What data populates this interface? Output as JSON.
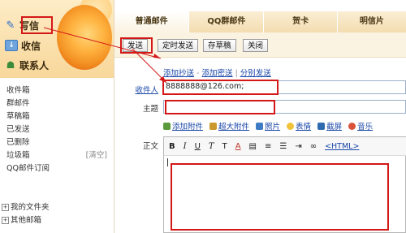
{
  "sidebar": {
    "write_label": "写信",
    "inbox_label": "收信",
    "contacts_label": "联系人",
    "folders": [
      {
        "label": "收件箱",
        "extra": ""
      },
      {
        "label": "群邮件",
        "extra": ""
      },
      {
        "label": "草稿箱",
        "extra": ""
      },
      {
        "label": "已发送",
        "extra": ""
      },
      {
        "label": "已删除",
        "extra": ""
      },
      {
        "label": "垃圾箱",
        "extra": "[清空]"
      },
      {
        "label": "QQ邮件订阅",
        "extra": ""
      }
    ],
    "tree": [
      {
        "label": "我的文件夹"
      },
      {
        "label": "其他邮箱"
      }
    ]
  },
  "tabs": [
    "普通邮件",
    "QQ群邮件",
    "贺卡",
    "明信片"
  ],
  "toolbar": {
    "send": "发送",
    "scheduled": "定时发送",
    "draft": "存草稿",
    "close": "关闭"
  },
  "compose": {
    "add_cc": "添加抄送",
    "add_bcc": "添加密送",
    "separate_send": "分别发送",
    "separator": "-",
    "separator2": "|",
    "recipient_label": "收件人",
    "recipient_value": "8888888@126.com;",
    "subject_label": "主题",
    "subject_value": "",
    "body_label": "正文"
  },
  "attach_bar": {
    "add_attachment": "添加附件",
    "big_attachment": "超大附件",
    "photo": "照片",
    "emoji": "表情",
    "screenshot": "截屏",
    "music": "音乐"
  },
  "editor_toolbar": {
    "bold": "B",
    "italic": "I",
    "underline": "U",
    "font": "T",
    "size": "T",
    "color": "A",
    "html_mode": "<HTML>"
  },
  "colors": {
    "accent_red": "#d41818",
    "link_blue": "#1a47a8",
    "tab_bg": "#f3dcb0"
  }
}
